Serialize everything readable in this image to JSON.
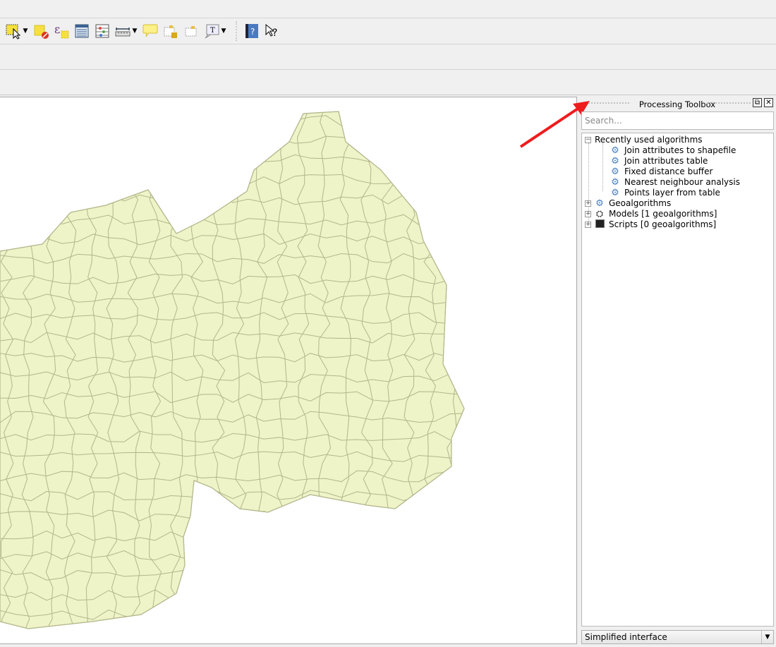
{
  "toolbar": {
    "items": [
      {
        "icon": "select-features-icon",
        "dropdown": true
      },
      {
        "icon": "deselect-features-icon"
      },
      {
        "icon": "select-by-expression-icon"
      },
      {
        "icon": "attribute-table-icon"
      },
      {
        "icon": "field-calculator-icon"
      },
      {
        "icon": "measure-line-icon",
        "dropdown": true
      },
      {
        "icon": "map-tips-icon"
      },
      {
        "icon": "new-bookmark-icon"
      },
      {
        "icon": "show-bookmarks-icon"
      },
      {
        "icon": "text-annotation-icon",
        "dropdown": true
      },
      {
        "icon": "help-contents-icon"
      },
      {
        "icon": "whats-this-icon"
      }
    ]
  },
  "panel": {
    "title": "Processing Toolbox",
    "search_placeholder": "Search...",
    "tree": {
      "recent": {
        "label": "Recently used algorithms",
        "expanded": true,
        "items": [
          "Join attributes to shapefile",
          "Join attributes table",
          "Fixed distance buffer",
          "Nearest neighbour analysis",
          "Points layer from table"
        ]
      },
      "groups": [
        {
          "label": "Geoalgorithms",
          "icon": "gear-icon"
        },
        {
          "label": "Models [1 geoalgorithms]",
          "icon": "models-icon"
        },
        {
          "label": "Scripts [0 geoalgorithms]",
          "icon": "scripts-icon"
        }
      ]
    },
    "mode_select": "Simplified interface"
  },
  "colors": {
    "map_fill": "#eef3c8",
    "map_stroke": "#b3b68a",
    "annotation_arrow": "#ee1c1c",
    "accent_gear": "#4a7fc0"
  }
}
